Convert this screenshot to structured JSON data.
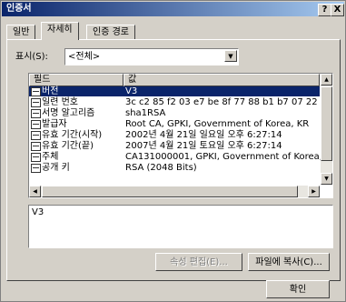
{
  "window": {
    "title": "인증서",
    "help_label": "?",
    "close_label": "X"
  },
  "tabs": [
    {
      "label": "일반"
    },
    {
      "label": "자세히"
    },
    {
      "label": "인증 경로"
    }
  ],
  "show": {
    "label": "표시(S):",
    "selected": "<전체>",
    "dropdown_icon": "▼"
  },
  "table": {
    "columns": [
      "필드",
      "값"
    ],
    "rows": [
      {
        "field": "버전",
        "value": "V3",
        "selected": true
      },
      {
        "field": "일련 번호",
        "value": "3c c2 85 f2 03 e7 be 8f 77 88 b1 b7 07 22 ec dd"
      },
      {
        "field": "서명 알고리즘",
        "value": "sha1RSA"
      },
      {
        "field": "발급자",
        "value": "Root CA, GPKI, Government of Korea, KR"
      },
      {
        "field": "유효 기간(시작)",
        "value": "2002년 4월 21일 일요일 오후 6:27:14"
      },
      {
        "field": "유효 기간(끝)",
        "value": "2007년 4월 21일 토요일 오후 6:27:14"
      },
      {
        "field": "주체",
        "value": "CA131000001, GPKI, Government of Korea, KR"
      },
      {
        "field": "공개 키",
        "value": "RSA (2048 Bits)"
      }
    ]
  },
  "detail": {
    "text": "V3"
  },
  "buttons": {
    "edit_properties": "속성 편집(E)...",
    "copy_to_file": "파일에 복사(C)...",
    "ok": "확인"
  }
}
